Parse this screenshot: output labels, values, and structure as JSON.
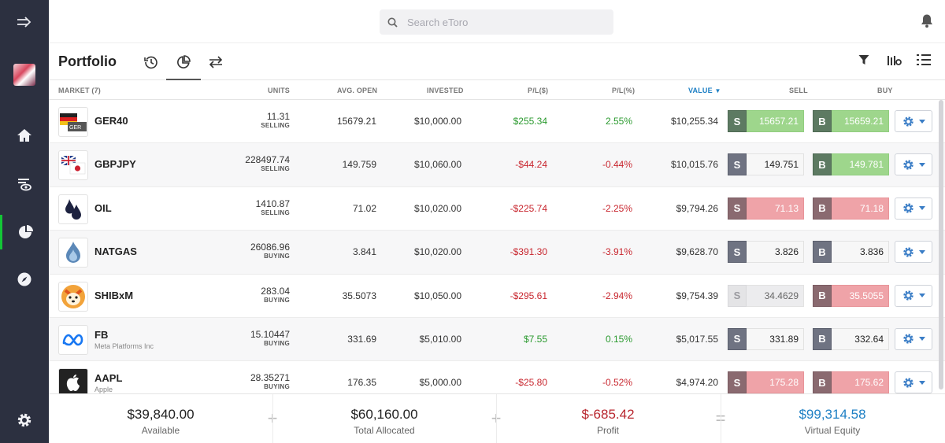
{
  "search": {
    "placeholder": "Search eToro"
  },
  "header": {
    "title": "Portfolio",
    "tabs": [
      {
        "icon": "history-icon"
      },
      {
        "icon": "pie-chart-icon"
      },
      {
        "icon": "swap-arrows-icon"
      }
    ]
  },
  "columns": {
    "market": "MARKET (7)",
    "units": "UNITS",
    "avg_open": "AVG. OPEN",
    "invested": "INVESTED",
    "pl_usd": "P/L($)",
    "pl_pct": "P/L(%)",
    "value": "VALUE",
    "sell": "SELL",
    "buy": "BUY"
  },
  "trade_labels": {
    "sell": "S",
    "buy": "B"
  },
  "rows": [
    {
      "symbol": "GER40",
      "name": "",
      "units": "11.31",
      "side": "SELLING",
      "avg_open": "15679.21",
      "invested": "$10,000.00",
      "pl_usd": "$255.34",
      "pl_pct": "2.55%",
      "value": "$10,255.34",
      "sell": "15657.21",
      "buy": "15659.21",
      "sell_state": "up",
      "buy_state": "up",
      "trend": "pos"
    },
    {
      "symbol": "GBPJPY",
      "name": "",
      "units": "228497.74",
      "side": "SELLING",
      "avg_open": "149.759",
      "invested": "$10,060.00",
      "pl_usd": "-$44.24",
      "pl_pct": "-0.44%",
      "value": "$10,015.76",
      "sell": "149.751",
      "buy": "149.781",
      "sell_state": "neutral",
      "buy_state": "up",
      "trend": "neg"
    },
    {
      "symbol": "OIL",
      "name": "",
      "units": "1410.87",
      "side": "SELLING",
      "avg_open": "71.02",
      "invested": "$10,020.00",
      "pl_usd": "-$225.74",
      "pl_pct": "-2.25%",
      "value": "$9,794.26",
      "sell": "71.13",
      "buy": "71.18",
      "sell_state": "down",
      "buy_state": "down",
      "trend": "neg"
    },
    {
      "symbol": "NATGAS",
      "name": "",
      "units": "26086.96",
      "side": "BUYING",
      "avg_open": "3.841",
      "invested": "$10,020.00",
      "pl_usd": "-$391.30",
      "pl_pct": "-3.91%",
      "value": "$9,628.70",
      "sell": "3.826",
      "buy": "3.836",
      "sell_state": "neutral",
      "buy_state": "neutral",
      "trend": "neg"
    },
    {
      "symbol": "SHIBxM",
      "name": "",
      "units": "283.04",
      "side": "BUYING",
      "avg_open": "35.5073",
      "invested": "$10,050.00",
      "pl_usd": "-$295.61",
      "pl_pct": "-2.94%",
      "value": "$9,754.39",
      "sell": "34.4629",
      "buy": "35.5055",
      "sell_state": "muted",
      "buy_state": "down",
      "trend": "neg"
    },
    {
      "symbol": "FB",
      "name": "Meta Platforms Inc",
      "units": "15.10447",
      "side": "BUYING",
      "avg_open": "331.69",
      "invested": "$5,010.00",
      "pl_usd": "$7.55",
      "pl_pct": "0.15%",
      "value": "$5,017.55",
      "sell": "331.89",
      "buy": "332.64",
      "sell_state": "neutral",
      "buy_state": "neutral",
      "trend": "pos"
    },
    {
      "symbol": "AAPL",
      "name": "Apple",
      "units": "28.35271",
      "side": "BUYING",
      "avg_open": "176.35",
      "invested": "$5,000.00",
      "pl_usd": "-$25.80",
      "pl_pct": "-0.52%",
      "value": "$4,974.20",
      "sell": "175.28",
      "buy": "175.62",
      "sell_state": "down",
      "buy_state": "down",
      "trend": "neg"
    }
  ],
  "footer": {
    "available": {
      "value": "$39,840.00",
      "label": "Available"
    },
    "allocated": {
      "value": "$60,160.00",
      "label": "Total Allocated"
    },
    "profit": {
      "value": "$-685.42",
      "label": "Profit"
    },
    "equity": {
      "value": "$99,314.58",
      "label": "Virtual Equity"
    },
    "ops": [
      "+",
      "+",
      "="
    ]
  },
  "colors": {
    "positive": "#2b9a2f",
    "negative": "#c8262e",
    "equity": "#1d7fc4",
    "profit": "#b8262e",
    "sidebar": "#2c3040",
    "active_nav": "#13c636"
  }
}
